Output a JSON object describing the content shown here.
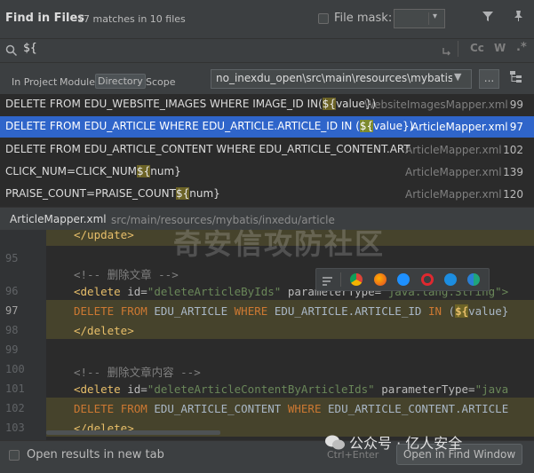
{
  "header": {
    "title": "Find in Files",
    "matches": "17 matches in 10 files",
    "file_mask_label": "File mask:"
  },
  "search": {
    "query": "${",
    "case_toggle": "Cc",
    "word_toggle": "W",
    "regex_toggle": ".*"
  },
  "scope": {
    "tabs": [
      "In Project",
      "Module",
      "Directory",
      "Scope"
    ],
    "selected": "Directory",
    "path": "no_inexdu_open\\src\\main\\resources\\mybatis",
    "browse_label": "..."
  },
  "results": [
    {
      "pre": "DELETE FROM EDU_WEBSITE_IMAGES WHERE IMAGE_ID IN(",
      "hl": "${",
      "post": "value})",
      "file": "WebsiteImagesMapper.xml",
      "line": "99",
      "selected": false
    },
    {
      "pre": "DELETE FROM EDU_ARTICLE WHERE EDU_ARTICLE.ARTICLE_ID IN (",
      "hl": "${",
      "post": "value})",
      "file": "ArticleMapper.xml",
      "line": "97",
      "selected": true
    },
    {
      "pre": "DELETE FROM EDU_ARTICLE_CONTENT WHERE EDU_ARTICLE_CONTENT.ART",
      "hl": "",
      "post": "",
      "file": "ArticleMapper.xml",
      "line": "102",
      "selected": false
    },
    {
      "pre": "CLICK_NUM=CLICK_NUM",
      "hl": "${",
      "post": "num}",
      "file": "ArticleMapper.xml",
      "line": "139",
      "selected": false
    },
    {
      "pre": "PRAISE_COUNT=PRAISE_COUNT",
      "hl": "${",
      "post": "num}",
      "file": "ArticleMapper.xml",
      "line": "120",
      "selected": false
    }
  ],
  "preview": {
    "file": "ArticleMapper.xml",
    "path": "src/main/resources/mybatis/inxedu/article"
  },
  "editor": {
    "line_numbers": [
      "",
      "95",
      "96",
      "97",
      "98",
      "99",
      "100",
      "101",
      "102",
      "103"
    ],
    "current_line": "97",
    "lines": {
      "l0": "</update>",
      "l95": "<!-- 删除文章 -->",
      "l96_open": "<delete",
      "l96_id_attr": "id=",
      "l96_id_val": "\"deleteArticleByIds\"",
      "l96_pt_attr": "parameterType=",
      "l96_pt_val": "\"java.lang.String\">",
      "l97_a": "DELETE",
      "l97_b": "FROM",
      "l97_c": "EDU_ARTICLE",
      "l97_d": "WHERE",
      "l97_e": "EDU_ARTICLE.ARTICLE_ID",
      "l97_f": "IN",
      "l97_g": "(",
      "l97_h": "${",
      "l97_i": "value}",
      "l98": "</delete>",
      "l100": "<!-- 删除文章内容 -->",
      "l101_open": "<delete",
      "l101_id_attr": "id=",
      "l101_id_val": "\"deleteArticleContentByArticleIds\"",
      "l101_pt_attr": "parameterType=",
      "l101_pt_val": "\"java",
      "l102_a": "DELETE",
      "l102_b": "FROM",
      "l102_c": "EDU_ARTICLE_CONTENT",
      "l102_d": "WHERE",
      "l102_e": "EDU_ARTICLE_CONTENT.ARTICLE",
      "l103": "</delete>"
    }
  },
  "watermark": "奇安信攻防社区",
  "footer": {
    "open_results_label": "Open results in new tab",
    "shortcut": "Ctrl+Enter",
    "open_window_button": "Open in Find Window",
    "wechat_label": "公众号 · 亿人安全"
  },
  "colors": {
    "selection": "#2f65ca",
    "match_highlight": "#6c6326",
    "keyword": "#cc7832",
    "tag": "#e8bf6a",
    "string": "#6a8759"
  }
}
